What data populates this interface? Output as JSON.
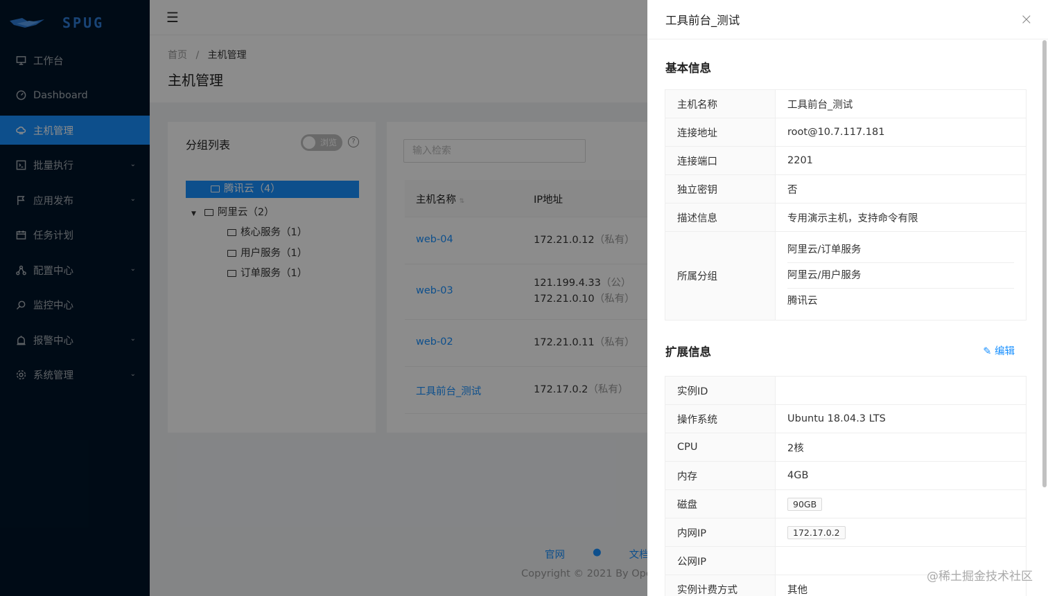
{
  "app": {
    "logo": "SPUG"
  },
  "sidebar": {
    "items": [
      {
        "label": "工作台",
        "icon": "monitor-icon",
        "expandable": false
      },
      {
        "label": "Dashboard",
        "icon": "dashboard-icon",
        "expandable": false
      },
      {
        "label": "主机管理",
        "icon": "cloud-server-icon",
        "expandable": false,
        "active": true
      },
      {
        "label": "批量执行",
        "icon": "code-icon",
        "expandable": true
      },
      {
        "label": "应用发布",
        "icon": "flag-icon",
        "expandable": true
      },
      {
        "label": "任务计划",
        "icon": "calendar-icon",
        "expandable": false
      },
      {
        "label": "配置中心",
        "icon": "deployment-icon",
        "expandable": true
      },
      {
        "label": "监控中心",
        "icon": "monitor-search-icon",
        "expandable": false
      },
      {
        "label": "报警中心",
        "icon": "alert-icon",
        "expandable": true
      },
      {
        "label": "系统管理",
        "icon": "setting-icon",
        "expandable": true
      }
    ]
  },
  "breadcrumb": {
    "home": "首页",
    "sep": "/",
    "current": "主机管理"
  },
  "page": {
    "title": "主机管理"
  },
  "groups": {
    "title": "分组列表",
    "toggle_label": "浏览",
    "help": "?",
    "tree": [
      {
        "label": "腾讯云（4）",
        "selected": true
      },
      {
        "label": "阿里云（2）",
        "expanded": true
      },
      {
        "label": "核心服务（1）"
      },
      {
        "label": "用户服务（1）"
      },
      {
        "label": "订单服务（1）"
      }
    ]
  },
  "hosts": {
    "search_placeholder": "输入检索",
    "columns": [
      "主机名称",
      "IP地址"
    ],
    "rows": [
      {
        "name": "web-04",
        "ips": [
          {
            "ip": "172.21.0.12",
            "type": "（私有）"
          }
        ]
      },
      {
        "name": "web-03",
        "ips": [
          {
            "ip": "121.199.4.33",
            "type": "（公）"
          },
          {
            "ip": "172.21.0.10",
            "type": "（私有）"
          }
        ]
      },
      {
        "name": "web-02",
        "ips": [
          {
            "ip": "172.21.0.11",
            "type": "（私有）"
          }
        ]
      },
      {
        "name": "工具前台_测试",
        "ips": [
          {
            "ip": "172.17.0.2",
            "type": "（私有）"
          }
        ]
      }
    ]
  },
  "footer": {
    "links": [
      "官网",
      "",
      "文档"
    ],
    "copyright": "Copyright © 2021 By Ope"
  },
  "drawer": {
    "title": "工具前台_测试",
    "close": "×",
    "basic_title": "基本信息",
    "basic": [
      {
        "k": "主机名称",
        "v": "工具前台_测试"
      },
      {
        "k": "连接地址",
        "v": "root@10.7.117.181"
      },
      {
        "k": "连接端口",
        "v": "2201"
      },
      {
        "k": "独立密钥",
        "v": "否"
      },
      {
        "k": "描述信息",
        "v": "专用演示主机，支持命令有限"
      }
    ],
    "group_label": "所属分组",
    "groups": [
      "阿里云/订单服务",
      "阿里云/用户服务",
      "腾讯云"
    ],
    "ext_title": "扩展信息",
    "edit": "编辑",
    "ext": [
      {
        "k": "实例ID",
        "v": ""
      },
      {
        "k": "操作系统",
        "v": "Ubuntu 18.04.3 LTS"
      },
      {
        "k": "CPU",
        "v": "2核"
      },
      {
        "k": "内存",
        "v": "4GB"
      },
      {
        "k": "磁盘",
        "v": "90GB",
        "tag": true
      },
      {
        "k": "内网IP",
        "v": "172.17.0.2",
        "tag": true
      },
      {
        "k": "公网IP",
        "v": ""
      },
      {
        "k": "实例计费方式",
        "v": "其他"
      }
    ]
  },
  "watermark": "@稀土掘金技术社区"
}
